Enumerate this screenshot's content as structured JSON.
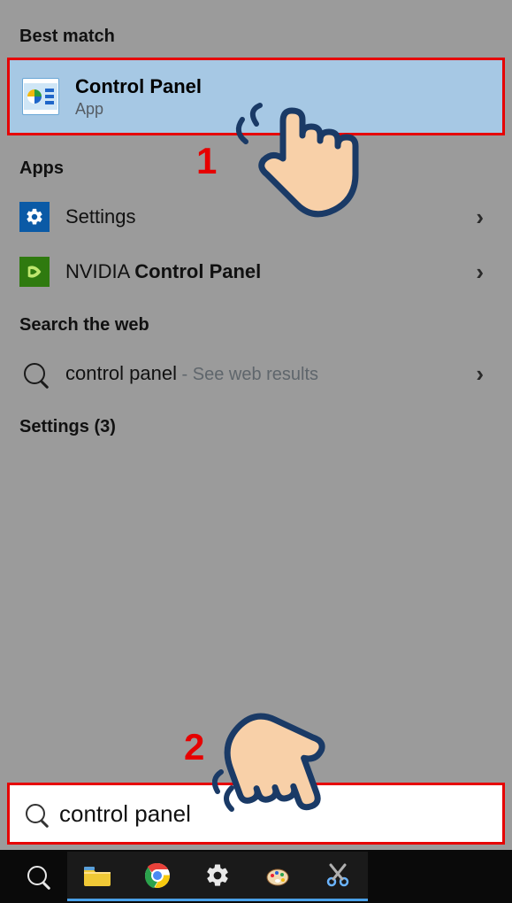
{
  "sections": {
    "best_match_header": "Best match",
    "apps_header": "Apps",
    "search_web_header": "Search the web",
    "settings_header": "Settings (3)"
  },
  "best_match": {
    "title": "Control Panel",
    "subtitle": "App"
  },
  "apps": [
    {
      "label": "Settings",
      "icon": "settings"
    },
    {
      "label_prefix": "NVIDIA ",
      "label_bold": "Control Panel",
      "icon": "nvidia"
    }
  ],
  "web": {
    "query": "control panel",
    "suffix": " - See web results"
  },
  "search_input": {
    "value": "control panel"
  },
  "annotations": {
    "num1": "1",
    "num2": "2"
  },
  "taskbar": {
    "items": [
      "search",
      "explorer",
      "chrome",
      "settings",
      "paint",
      "snip"
    ]
  }
}
